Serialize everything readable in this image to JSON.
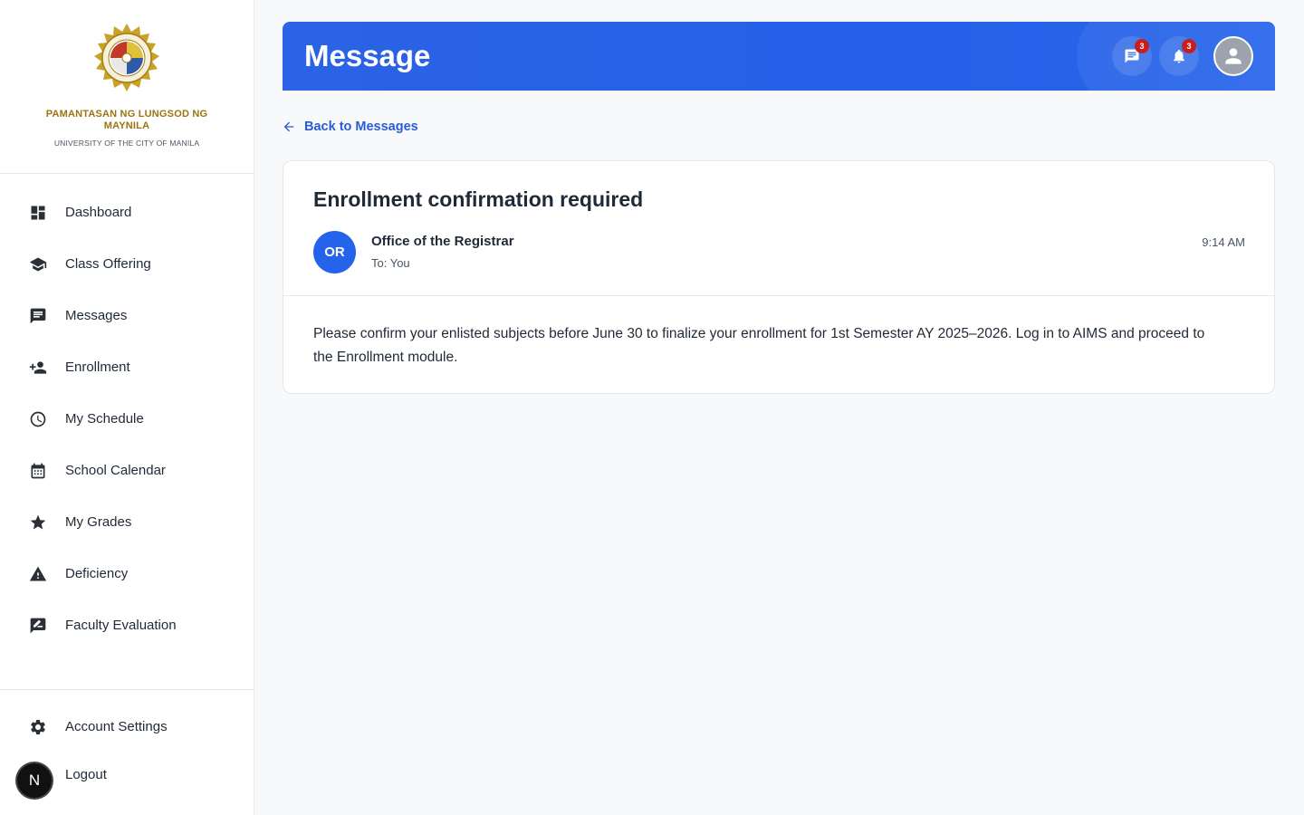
{
  "university": {
    "name": "PAMANTASAN NG LUNGSOD NG MAYNILA",
    "subtitle": "UNIVERSITY OF THE CITY OF MANILA",
    "seal_icon": "plm-seal"
  },
  "sidebar": {
    "items": [
      {
        "label": "Dashboard",
        "icon": "dashboard-icon"
      },
      {
        "label": "Class Offering",
        "icon": "school-icon"
      },
      {
        "label": "Messages",
        "icon": "chat-icon"
      },
      {
        "label": "Enrollment",
        "icon": "person-add-icon"
      },
      {
        "label": "My Schedule",
        "icon": "clock-icon"
      },
      {
        "label": "School Calendar",
        "icon": "calendar-icon"
      },
      {
        "label": "My Grades",
        "icon": "star-icon"
      },
      {
        "label": "Deficiency",
        "icon": "warning-icon"
      },
      {
        "label": "Faculty Evaluation",
        "icon": "rate-review-icon"
      }
    ],
    "bottom": [
      {
        "label": "Account Settings",
        "icon": "gear-icon"
      },
      {
        "label": "Logout",
        "icon": "logout-icon"
      }
    ],
    "user_initial": "N"
  },
  "header": {
    "title": "Message",
    "messages_badge": "3",
    "notifications_badge": "3",
    "colors": {
      "accent": "#2563eb",
      "badge": "#c81e1e"
    }
  },
  "back_link": "Back to Messages",
  "message": {
    "subject": "Enrollment confirmation required",
    "sender_initials": "OR",
    "sender": "Office of the Registrar",
    "recipient": "To: You",
    "time": "9:14 AM",
    "body": "Please confirm your enlisted subjects before June 30 to finalize your enrollment for 1st Semester AY 2025–2026. Log in to AIMS and proceed to the Enrollment module."
  }
}
